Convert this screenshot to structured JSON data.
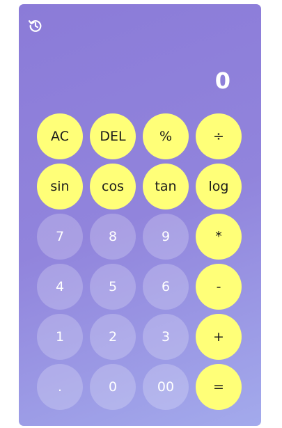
{
  "display": {
    "value": "0"
  },
  "history": {
    "icon": "history-icon"
  },
  "keys": [
    {
      "label": "AC",
      "name": "key-ac",
      "style": "yellow"
    },
    {
      "label": "DEL",
      "name": "key-del",
      "style": "yellow"
    },
    {
      "label": "%",
      "name": "key-percent",
      "style": "yellow"
    },
    {
      "label": "÷",
      "name": "key-divide",
      "style": "yellow"
    },
    {
      "label": "sin",
      "name": "key-sin",
      "style": "yellow"
    },
    {
      "label": "cos",
      "name": "key-cos",
      "style": "yellow"
    },
    {
      "label": "tan",
      "name": "key-tan",
      "style": "yellow"
    },
    {
      "label": "log",
      "name": "key-log",
      "style": "yellow"
    },
    {
      "label": "7",
      "name": "key-7",
      "style": "pale"
    },
    {
      "label": "8",
      "name": "key-8",
      "style": "pale"
    },
    {
      "label": "9",
      "name": "key-9",
      "style": "pale"
    },
    {
      "label": "*",
      "name": "key-multiply",
      "style": "yellow"
    },
    {
      "label": "4",
      "name": "key-4",
      "style": "pale"
    },
    {
      "label": "5",
      "name": "key-5",
      "style": "pale"
    },
    {
      "label": "6",
      "name": "key-6",
      "style": "pale"
    },
    {
      "label": "-",
      "name": "key-subtract",
      "style": "yellow"
    },
    {
      "label": "1",
      "name": "key-1",
      "style": "pale"
    },
    {
      "label": "2",
      "name": "key-2",
      "style": "pale"
    },
    {
      "label": "3",
      "name": "key-3",
      "style": "pale"
    },
    {
      "label": "+",
      "name": "key-add",
      "style": "yellow"
    },
    {
      "label": ".",
      "name": "key-decimal",
      "style": "pale"
    },
    {
      "label": "0",
      "name": "key-0",
      "style": "pale"
    },
    {
      "label": "00",
      "name": "key-00",
      "style": "pale"
    },
    {
      "label": "=",
      "name": "key-equals",
      "style": "yellow"
    }
  ],
  "colors": {
    "accent_key": "#ffff78",
    "background_start": "#8b7bd8",
    "background_end": "#a3aaec",
    "display_text": "#ffffff"
  }
}
